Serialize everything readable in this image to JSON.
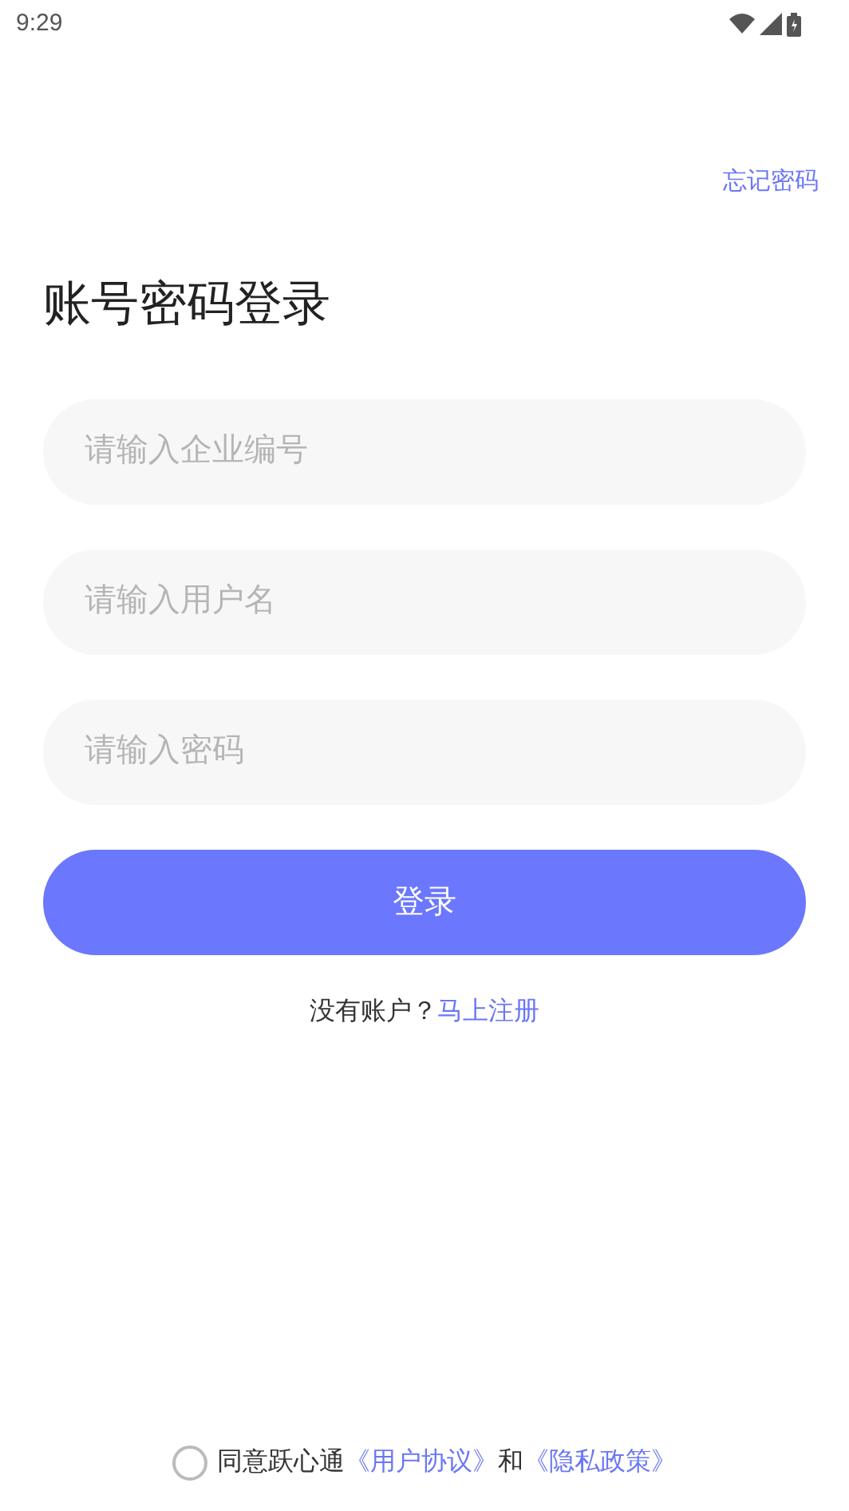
{
  "status_bar": {
    "time": "9:29"
  },
  "forgot_link": "忘记密码",
  "title": "账号密码登录",
  "fields": [
    {
      "placeholder": "请输入企业编号"
    },
    {
      "placeholder": "请输入用户名"
    },
    {
      "placeholder": "请输入密码"
    }
  ],
  "login_button": "登录",
  "register": {
    "prompt": "没有账户？",
    "link": "马上注册"
  },
  "agreement": {
    "checked": false,
    "text": "同意跃心通",
    "link_1": "《用户协议》",
    "conjunction": "和",
    "link_2": "《隐私政策》"
  }
}
